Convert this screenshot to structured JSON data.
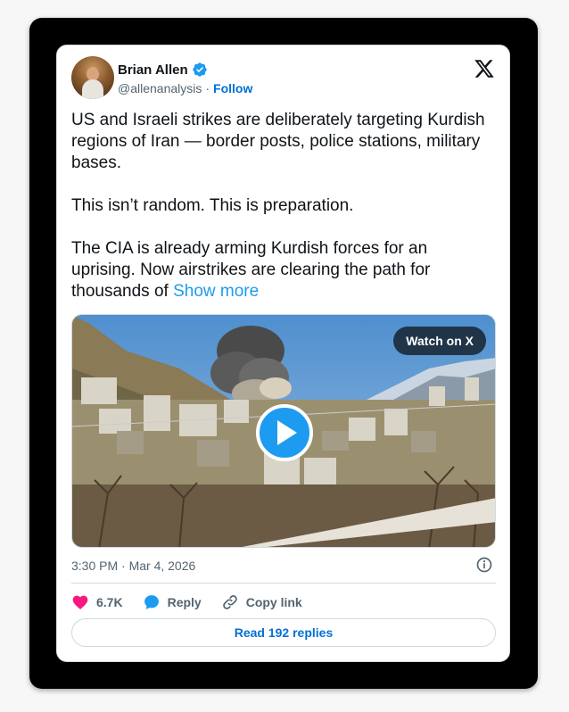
{
  "author": {
    "name": "Brian Allen",
    "handle": "@allenanalysis",
    "separator": "·",
    "follow_label": "Follow"
  },
  "tweet": {
    "paragraphs": [
      "US and Israeli strikes are deliberately targeting Kurdish regions of Iran — border posts, police stations, military bases.",
      "This isn’t random. This is preparation."
    ],
    "last_paragraph": "The CIA is already arming Kurdish forces for an uprising. Now airstrikes are clearing the path for thousands of",
    "show_more_label": "Show more"
  },
  "media": {
    "watch_label": "Watch on X"
  },
  "timestamp": "3:30 PM · Mar 4, 2026",
  "actions": {
    "likes": "6.7K",
    "reply": "Reply",
    "copy_link": "Copy link"
  },
  "read_replies": "Read 192 replies",
  "colors": {
    "accent": "#1d9bf0",
    "link": "#006fd6",
    "like": "#f91880"
  },
  "icons": [
    "verified-badge-icon",
    "x-logo-icon",
    "play-icon",
    "info-icon",
    "heart-icon",
    "reply-bubble-icon",
    "link-icon"
  ]
}
